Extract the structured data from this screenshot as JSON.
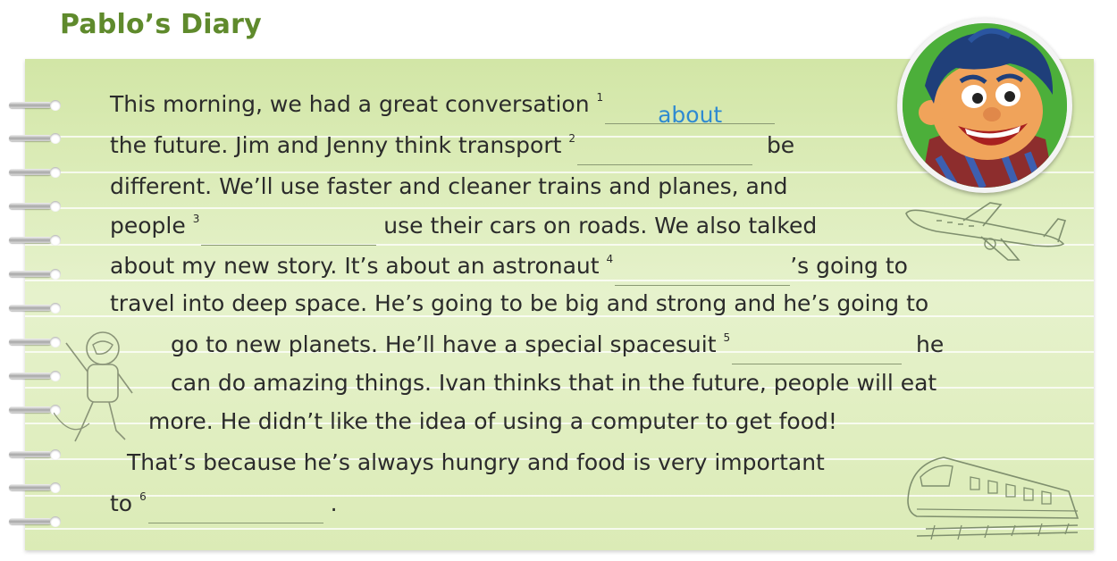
{
  "title": "Pablo’s Diary",
  "lines": {
    "l1": "This morning, we had a great conversation",
    "l1_num": "1",
    "l1_answer": "about",
    "l2a": "the future. Jim and Jenny think transport",
    "l2_num": "2",
    "l2b": "be",
    "l3": "different. We’ll use faster and cleaner trains and planes, and",
    "l4a": "people",
    "l4_num": "3",
    "l4b": "use their cars on roads.  We also talked",
    "l5a": "about my new story. It’s about an astronaut",
    "l5_num": "4",
    "l5b": "’s going to",
    "l6": "travel into deep space. He’s going to be big and strong and he’s going to",
    "l7a": "go to new planets. He’ll have a special spacesuit",
    "l7_num": "5",
    "l7b": "he",
    "l8": "can do amazing things. Ivan thinks that in the future, people will eat",
    "l9": "more. He didn’t like the idea of using a computer to get food!",
    "l10": "That’s because he’s always hungry and food is very important",
    "l11a": "to",
    "l11_num": "6",
    "l11b": "."
  },
  "colors": {
    "title": "#5f8a2c",
    "answer": "#2f8ad1",
    "paper": "#dcecb8"
  },
  "illustrations": [
    "pablo-avatar",
    "airplane-sketch",
    "astronaut-sketch",
    "train-sketch"
  ]
}
